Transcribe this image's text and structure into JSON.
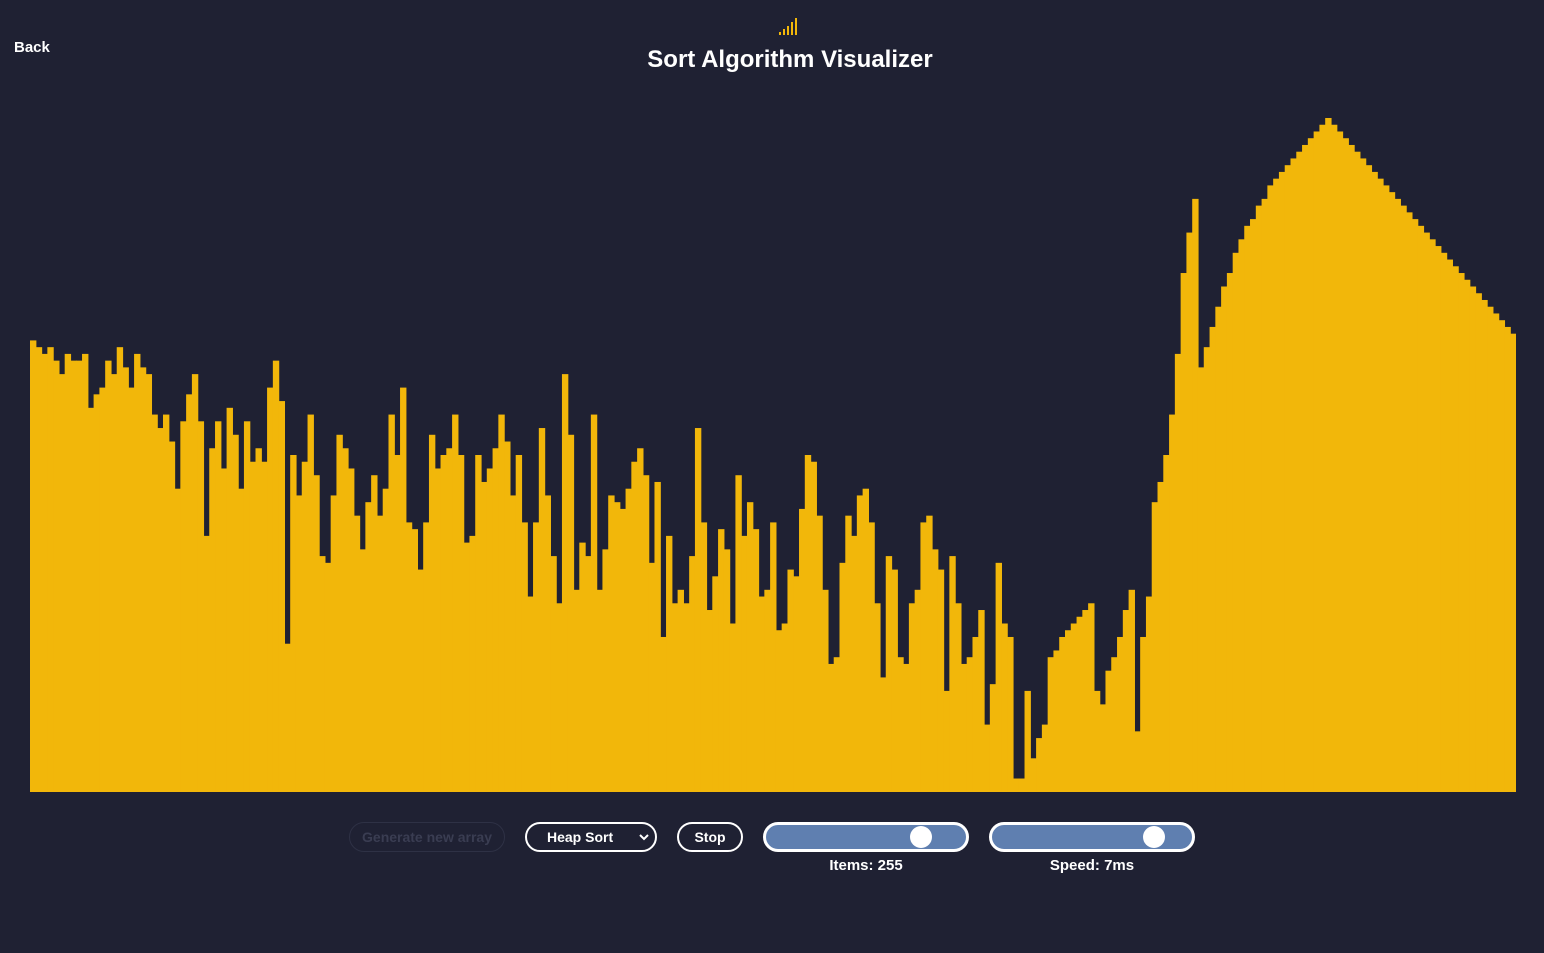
{
  "nav": {
    "back_label": "Back"
  },
  "header": {
    "title": "Sort Algorithm Visualizer",
    "logo_icon": "signal-bars-icon"
  },
  "colors": {
    "background": "#1f2133",
    "bar": "#f2b70a",
    "slider_fill": "#5f7fb0",
    "text": "#ffffff"
  },
  "controls": {
    "generate_label": "Generate new array",
    "generate_disabled": true,
    "algorithm_selected": "Heap Sort",
    "stop_label": "Stop",
    "items_label": "Items: 255",
    "items_value": 255,
    "items_slider_fraction": 0.82,
    "speed_label": "Speed: 7ms",
    "speed_slider_fraction": 0.86
  },
  "chart_data": {
    "type": "bar",
    "count": 255,
    "color": "#f2b70a",
    "values_fraction_of_max": [
      0.67,
      0.66,
      0.65,
      0.66,
      0.64,
      0.62,
      0.65,
      0.64,
      0.64,
      0.65,
      0.57,
      0.59,
      0.6,
      0.64,
      0.62,
      0.66,
      0.63,
      0.6,
      0.65,
      0.63,
      0.62,
      0.56,
      0.54,
      0.56,
      0.52,
      0.45,
      0.55,
      0.59,
      0.62,
      0.55,
      0.38,
      0.51,
      0.55,
      0.48,
      0.57,
      0.53,
      0.45,
      0.55,
      0.49,
      0.51,
      0.49,
      0.6,
      0.64,
      0.58,
      0.22,
      0.5,
      0.44,
      0.49,
      0.56,
      0.47,
      0.35,
      0.34,
      0.44,
      0.53,
      0.51,
      0.48,
      0.41,
      0.36,
      0.43,
      0.47,
      0.41,
      0.45,
      0.56,
      0.5,
      0.6,
      0.4,
      0.39,
      0.33,
      0.4,
      0.53,
      0.48,
      0.5,
      0.51,
      0.56,
      0.5,
      0.37,
      0.38,
      0.5,
      0.46,
      0.48,
      0.51,
      0.56,
      0.52,
      0.44,
      0.5,
      0.4,
      0.29,
      0.4,
      0.54,
      0.44,
      0.35,
      0.28,
      0.62,
      0.53,
      0.3,
      0.37,
      0.35,
      0.56,
      0.3,
      0.36,
      0.44,
      0.43,
      0.42,
      0.45,
      0.49,
      0.51,
      0.47,
      0.34,
      0.46,
      0.23,
      0.38,
      0.28,
      0.3,
      0.28,
      0.35,
      0.54,
      0.4,
      0.27,
      0.32,
      0.39,
      0.36,
      0.25,
      0.47,
      0.38,
      0.43,
      0.39,
      0.29,
      0.3,
      0.4,
      0.24,
      0.25,
      0.33,
      0.32,
      0.42,
      0.5,
      0.49,
      0.41,
      0.3,
      0.19,
      0.2,
      0.34,
      0.41,
      0.38,
      0.44,
      0.45,
      0.4,
      0.28,
      0.17,
      0.35,
      0.33,
      0.2,
      0.19,
      0.28,
      0.3,
      0.4,
      0.41,
      0.36,
      0.33,
      0.15,
      0.35,
      0.28,
      0.19,
      0.2,
      0.23,
      0.27,
      0.1,
      0.16,
      0.34,
      0.25,
      0.23,
      0.02,
      0.02,
      0.15,
      0.05,
      0.08,
      0.1,
      0.2,
      0.21,
      0.23,
      0.24,
      0.25,
      0.26,
      0.27,
      0.28,
      0.15,
      0.13,
      0.18,
      0.2,
      0.23,
      0.27,
      0.3,
      0.09,
      0.23,
      0.29,
      0.43,
      0.46,
      0.5,
      0.56,
      0.65,
      0.77,
      0.83,
      0.88,
      0.63,
      0.66,
      0.69,
      0.72,
      0.75,
      0.77,
      0.8,
      0.82,
      0.84,
      0.85,
      0.87,
      0.88,
      0.9,
      0.91,
      0.92,
      0.93,
      0.94,
      0.95,
      0.96,
      0.97,
      0.98,
      0.99,
      1.0,
      0.99,
      0.98,
      0.97,
      0.96,
      0.95,
      0.94,
      0.93,
      0.92,
      0.91,
      0.9,
      0.89,
      0.88,
      0.87,
      0.86,
      0.85,
      0.84,
      0.83,
      0.82,
      0.81,
      0.8,
      0.79,
      0.78,
      0.77,
      0.76,
      0.75,
      0.74,
      0.73,
      0.72,
      0.71,
      0.7,
      0.69,
      0.68
    ]
  }
}
